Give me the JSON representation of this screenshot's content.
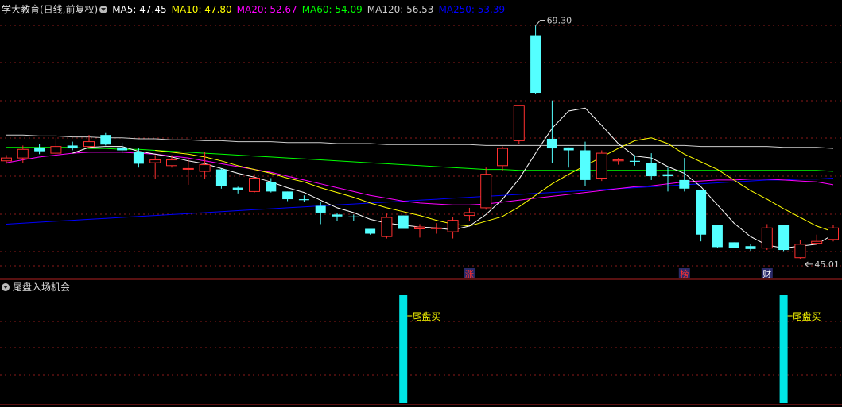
{
  "header": {
    "title": "学大教育(日线,前复权)",
    "ma": [
      {
        "label": "MA5: 47.45",
        "color": "#ffffff"
      },
      {
        "label": "MA10: 47.80",
        "color": "#ffff00"
      },
      {
        "label": "MA20: 52.67",
        "color": "#ff00ff"
      },
      {
        "label": "MA60: 54.09",
        "color": "#00ff00"
      },
      {
        "label": "MA120: 56.53",
        "color": "#cccccc"
      },
      {
        "label": "MA250: 53.39",
        "color": "#0000ff"
      }
    ]
  },
  "sub_panel": {
    "title": "尾盘入场机会"
  },
  "chart_data": {
    "type": "candlestick",
    "high_label": "69.30",
    "low_label": "45.01",
    "markers": [
      {
        "label": "涨",
        "index": 28,
        "color": "#ff3030"
      },
      {
        "label": "榜",
        "index": 41,
        "color": "#ff3030"
      },
      {
        "label": "财",
        "index": 46,
        "color": "#ffffff"
      }
    ],
    "candles": [
      [
        55.2,
        55.8,
        54.9,
        55.5
      ],
      [
        55.5,
        56.8,
        55.0,
        56.4
      ],
      [
        56.6,
        57.0,
        55.9,
        56.2
      ],
      [
        56.0,
        57.6,
        55.7,
        56.7
      ],
      [
        56.8,
        57.2,
        56.3,
        56.5
      ],
      [
        56.7,
        57.9,
        56.5,
        57.2
      ],
      [
        57.9,
        58.1,
        56.8,
        56.9
      ],
      [
        56.6,
        57.1,
        56.0,
        56.3
      ],
      [
        56.1,
        56.5,
        54.5,
        54.9
      ],
      [
        55.0,
        55.8,
        53.3,
        55.3
      ],
      [
        54.7,
        55.8,
        54.5,
        55.3
      ],
      [
        54.4,
        55.5,
        52.7,
        54.4
      ],
      [
        54.1,
        56.1,
        53.3,
        54.8
      ],
      [
        54.3,
        54.4,
        52.3,
        52.6
      ],
      [
        52.4,
        52.5,
        51.8,
        52.2
      ],
      [
        52.0,
        53.8,
        51.9,
        53.4
      ],
      [
        53.0,
        53.4,
        51.9,
        52.0
      ],
      [
        52.0,
        52.0,
        51.0,
        51.2
      ],
      [
        51.2,
        51.6,
        50.9,
        51.1
      ],
      [
        50.5,
        50.9,
        48.6,
        49.8
      ],
      [
        49.6,
        49.8,
        48.9,
        49.4
      ],
      [
        49.4,
        49.6,
        48.9,
        49.3
      ],
      [
        48.1,
        48.1,
        47.5,
        47.6
      ],
      [
        47.3,
        49.7,
        47.1,
        49.3
      ],
      [
        49.5,
        49.5,
        48.2,
        48.1
      ],
      [
        48.1,
        48.6,
        47.2,
        48.3
      ],
      [
        48.2,
        48.7,
        47.6,
        48.2
      ],
      [
        47.8,
        49.3,
        47.1,
        49.0
      ],
      [
        49.5,
        50.3,
        48.9,
        49.8
      ],
      [
        50.3,
        54.5,
        50.1,
        53.8
      ],
      [
        54.7,
        56.7,
        54.1,
        56.5
      ],
      [
        57.3,
        58.0,
        57.0,
        61.0
      ],
      [
        68.3,
        69.3,
        62.2,
        62.3
      ],
      [
        57.5,
        61.5,
        55.0,
        56.5
      ],
      [
        56.6,
        56.6,
        54.5,
        56.3
      ],
      [
        56.3,
        57.2,
        52.6,
        53.2
      ],
      [
        53.4,
        56.3,
        53.1,
        56.0
      ],
      [
        55.2,
        55.5,
        54.8,
        55.3
      ],
      [
        55.2,
        55.8,
        54.7,
        55.1
      ],
      [
        55.0,
        56.0,
        53.2,
        53.6
      ],
      [
        53.8,
        54.5,
        52.0,
        53.6
      ],
      [
        53.2,
        55.5,
        52.0,
        52.3
      ],
      [
        52.2,
        52.2,
        46.8,
        47.5
      ],
      [
        48.5,
        48.5,
        46.1,
        46.2
      ],
      [
        46.7,
        46.7,
        46.1,
        46.1
      ],
      [
        46.3,
        46.5,
        45.8,
        46.0
      ],
      [
        46.1,
        48.6,
        45.9,
        48.2
      ],
      [
        48.5,
        48.5,
        45.7,
        45.9
      ],
      [
        45.1,
        46.9,
        45.0,
        46.5
      ],
      [
        46.6,
        47.5,
        46.5,
        46.8
      ],
      [
        47.0,
        48.5,
        46.8,
        48.2
      ]
    ],
    "ma_series": {
      "MA5": [
        null,
        null,
        null,
        null,
        56.0,
        56.6,
        56.7,
        56.7,
        56.2,
        55.9,
        55.6,
        55.2,
        54.9,
        54.4,
        53.9,
        53.5,
        53.0,
        52.4,
        51.9,
        51.1,
        50.3,
        49.8,
        49.1,
        48.7,
        48.5,
        48.3,
        48.2,
        48.0,
        48.4,
        49.6,
        51.2,
        53.3,
        56.0,
        58.6,
        60.4,
        60.7,
        58.9,
        57.0,
        55.7,
        55.5,
        54.6,
        53.9,
        52.5,
        50.6,
        48.7,
        47.3,
        46.4,
        46.1,
        46.3,
        46.5,
        47.5
      ],
      "MA10": [
        null,
        null,
        null,
        null,
        null,
        null,
        null,
        null,
        null,
        56.3,
        56.1,
        55.9,
        55.6,
        55.2,
        54.7,
        54.3,
        53.9,
        53.4,
        53.0,
        52.4,
        51.9,
        51.4,
        50.8,
        50.3,
        49.9,
        49.5,
        49.0,
        48.6,
        48.4,
        48.9,
        49.4,
        50.4,
        51.6,
        52.8,
        53.8,
        54.7,
        55.6,
        56.5,
        57.3,
        57.6,
        57.0,
        55.9,
        55.1,
        54.3,
        53.2,
        52.1,
        51.2,
        50.2,
        49.3,
        48.4,
        47.8
      ],
      "MA20": [
        55.0,
        55.3,
        55.6,
        55.8,
        56.0,
        56.1,
        56.1,
        56.1,
        56.0,
        55.9,
        55.7,
        55.5,
        55.2,
        54.9,
        54.6,
        54.3,
        54.0,
        53.6,
        53.2,
        52.8,
        52.4,
        52.0,
        51.6,
        51.3,
        51.0,
        50.8,
        50.7,
        50.6,
        50.6,
        50.7,
        50.9,
        51.1,
        51.3,
        51.5,
        51.7,
        51.9,
        52.1,
        52.3,
        52.5,
        52.6,
        52.8,
        53.0,
        53.1,
        53.2,
        53.2,
        53.3,
        53.3,
        53.2,
        53.1,
        53.0,
        52.7
      ],
      "MA60": [
        56.6,
        56.6,
        56.6,
        56.6,
        56.6,
        56.5,
        56.5,
        56.4,
        56.4,
        56.3,
        56.2,
        56.1,
        56.0,
        55.9,
        55.8,
        55.7,
        55.6,
        55.5,
        55.4,
        55.3,
        55.2,
        55.1,
        55.0,
        54.9,
        54.8,
        54.7,
        54.6,
        54.5,
        54.4,
        54.3,
        54.3,
        54.2,
        54.2,
        54.2,
        54.2,
        54.2,
        54.2,
        54.2,
        54.2,
        54.2,
        54.2,
        54.2,
        54.2,
        54.2,
        54.2,
        54.2,
        54.2,
        54.2,
        54.2,
        54.2,
        54.1
      ],
      "MA120": [
        57.9,
        57.9,
        57.8,
        57.8,
        57.7,
        57.7,
        57.6,
        57.6,
        57.5,
        57.5,
        57.4,
        57.4,
        57.3,
        57.3,
        57.2,
        57.2,
        57.2,
        57.1,
        57.1,
        57.1,
        57.0,
        57.0,
        57.0,
        56.9,
        56.9,
        56.9,
        56.9,
        56.9,
        56.9,
        56.8,
        56.8,
        56.8,
        56.8,
        56.8,
        56.8,
        56.8,
        56.8,
        56.8,
        56.8,
        56.8,
        56.8,
        56.8,
        56.7,
        56.7,
        56.7,
        56.7,
        56.7,
        56.6,
        56.6,
        56.6,
        56.5
      ],
      "MA250": [
        48.6,
        48.7,
        48.8,
        48.9,
        49.0,
        49.1,
        49.2,
        49.3,
        49.4,
        49.5,
        49.6,
        49.7,
        49.8,
        49.9,
        50.0,
        50.1,
        50.2,
        50.3,
        50.4,
        50.5,
        50.6,
        50.7,
        50.8,
        50.9,
        51.0,
        51.1,
        51.2,
        51.3,
        51.4,
        51.5,
        51.6,
        51.7,
        51.8,
        51.9,
        52.0,
        52.1,
        52.2,
        52.3,
        52.4,
        52.5,
        52.6,
        52.7,
        52.8,
        52.9,
        53.0,
        53.1,
        53.2,
        53.2,
        53.3,
        53.3,
        53.4
      ]
    },
    "signals": [
      {
        "index": 24,
        "label": "尾盘买"
      },
      {
        "index": 47,
        "label": "尾盘买"
      }
    ],
    "ylim": [
      44,
      70.5
    ],
    "colors": {
      "up": "#ff3030",
      "down": "#54ffff",
      "MA5": "#ffffff",
      "MA10": "#ffff00",
      "MA20": "#ff00ff",
      "MA60": "#00ff00",
      "MA120": "#cccccc",
      "MA250": "#0000ff",
      "grid": "#8b1a1a",
      "signal": "#00e5e5",
      "signal_label": "#ffff00"
    }
  }
}
